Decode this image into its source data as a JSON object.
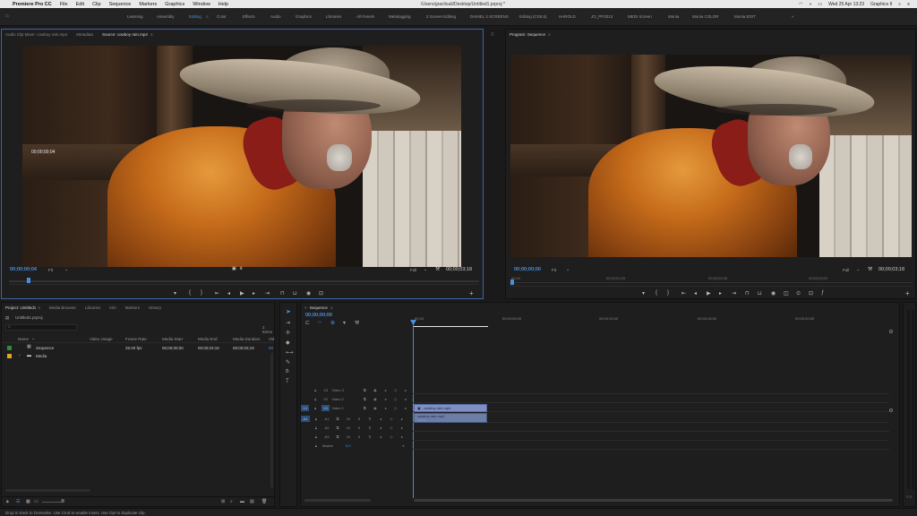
{
  "menubar": {
    "app_name": "Premiere Pro CC",
    "items": [
      "File",
      "Edit",
      "Clip",
      "Sequence",
      "Markers",
      "Graphics",
      "Window",
      "Help"
    ],
    "doc_path": "/Users/gracliouli/Desktop/Untitled1.prproj *",
    "clock": "Wed 25 Apr  13:23",
    "user": "Graphics II"
  },
  "workspaces": {
    "items": [
      "Learning",
      "Assembly",
      "Editing",
      "Color",
      "Effects",
      "Audio",
      "Graphics",
      "Libraries",
      "All Panels",
      "Metalogging",
      "2 Screen Editing",
      "DANIEL 2 SCREENS",
      "Editing (CS5.5)",
      "HAROLD",
      "JO_PP2013",
      "MEDI Screen",
      "Monia",
      "Monia COLOR",
      "Monia EDIT"
    ],
    "active": "Editing",
    "more": "»"
  },
  "source": {
    "tabs": [
      "Audio Clip Mixer: cowboy rain.mp4",
      "Metadata",
      "Source: cowboy rain.mp4"
    ],
    "overlay_tc": "00;00;00;04",
    "current_tc": "00;00;00;04",
    "fit": "Fit",
    "quality": "Full",
    "duration": "00;00;03;18"
  },
  "program": {
    "tab": "Program: Sequence",
    "current_tc": "00;00;00;00",
    "fit": "Fit",
    "quality": "Full",
    "duration": "00;00;03;18",
    "ruler": [
      "00;00",
      "00;00;01;00",
      "00;00;02;00",
      "00;00;03;00"
    ]
  },
  "project": {
    "tabs": [
      "Project: Untitled1",
      "Media Browser",
      "Libraries",
      "Info",
      "Markers",
      "History"
    ],
    "file": "Untitled1.prproj",
    "count": "2 Items",
    "columns": [
      "Name",
      "Video Usage",
      "Frame Rate",
      "Media Start",
      "Media End",
      "Media Duration",
      "Vid"
    ],
    "rows": [
      {
        "name": "Sequence",
        "frame_rate": "25.00 fps",
        "start": "00;00;00;00",
        "end": "00;00;03;18",
        "duration": "00;00;03;19",
        "vid": "00"
      },
      {
        "name": "Media",
        "frame_rate": "",
        "start": "",
        "end": "",
        "duration": "",
        "vid": ""
      }
    ],
    "swatch_colors": [
      "#2e8b3a",
      "#e8a126"
    ]
  },
  "timeline": {
    "tab": "Sequence",
    "tc": "00;00;00;00",
    "ruler": [
      "00;00",
      "00;00;05;00",
      "00;00;10;00",
      "00;00;15;00",
      "00;00;20;00"
    ],
    "video_tracks": [
      "Video 3",
      "Video 2",
      "Video 1"
    ],
    "video_ids": [
      "V3",
      "V2",
      "V1"
    ],
    "audio_ids": [
      "A1",
      "A2",
      "A3"
    ],
    "master": "Master",
    "master_val": "0.0",
    "clip_video": "cowboy rain.mp4",
    "clip_audio": "cowboy rain.mp4"
  },
  "status": "Drop in track to Overwrite. Use Cmd to enable insert. Use Opt to duplicate clip."
}
